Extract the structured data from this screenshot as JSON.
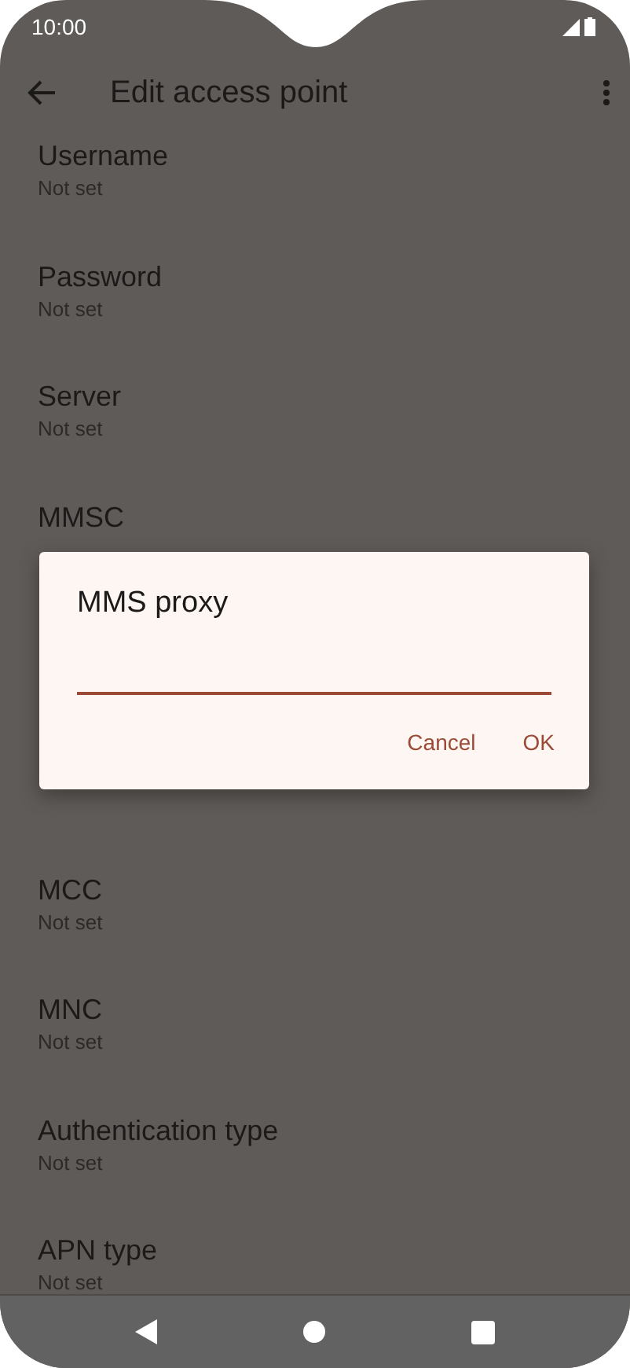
{
  "status_bar": {
    "time": "10:00"
  },
  "app_bar": {
    "title": "Edit access point"
  },
  "items_above": [
    {
      "title": "Username",
      "subtitle": "Not set"
    },
    {
      "title": "Password",
      "subtitle": "Not set"
    },
    {
      "title": "Server",
      "subtitle": "Not set"
    },
    {
      "title": "MMSC"
    }
  ],
  "dialog": {
    "title": "MMS proxy",
    "buttons": [
      "Cancel",
      "OK"
    ]
  },
  "items_below": [
    {
      "title": "MCC",
      "subtitle": "Not set"
    },
    {
      "title": "MNC",
      "subtitle": "Not set"
    },
    {
      "title": "Authentication type",
      "subtitle": "Not set"
    },
    {
      "title": "APN type",
      "subtitle": "Not set"
    }
  ]
}
